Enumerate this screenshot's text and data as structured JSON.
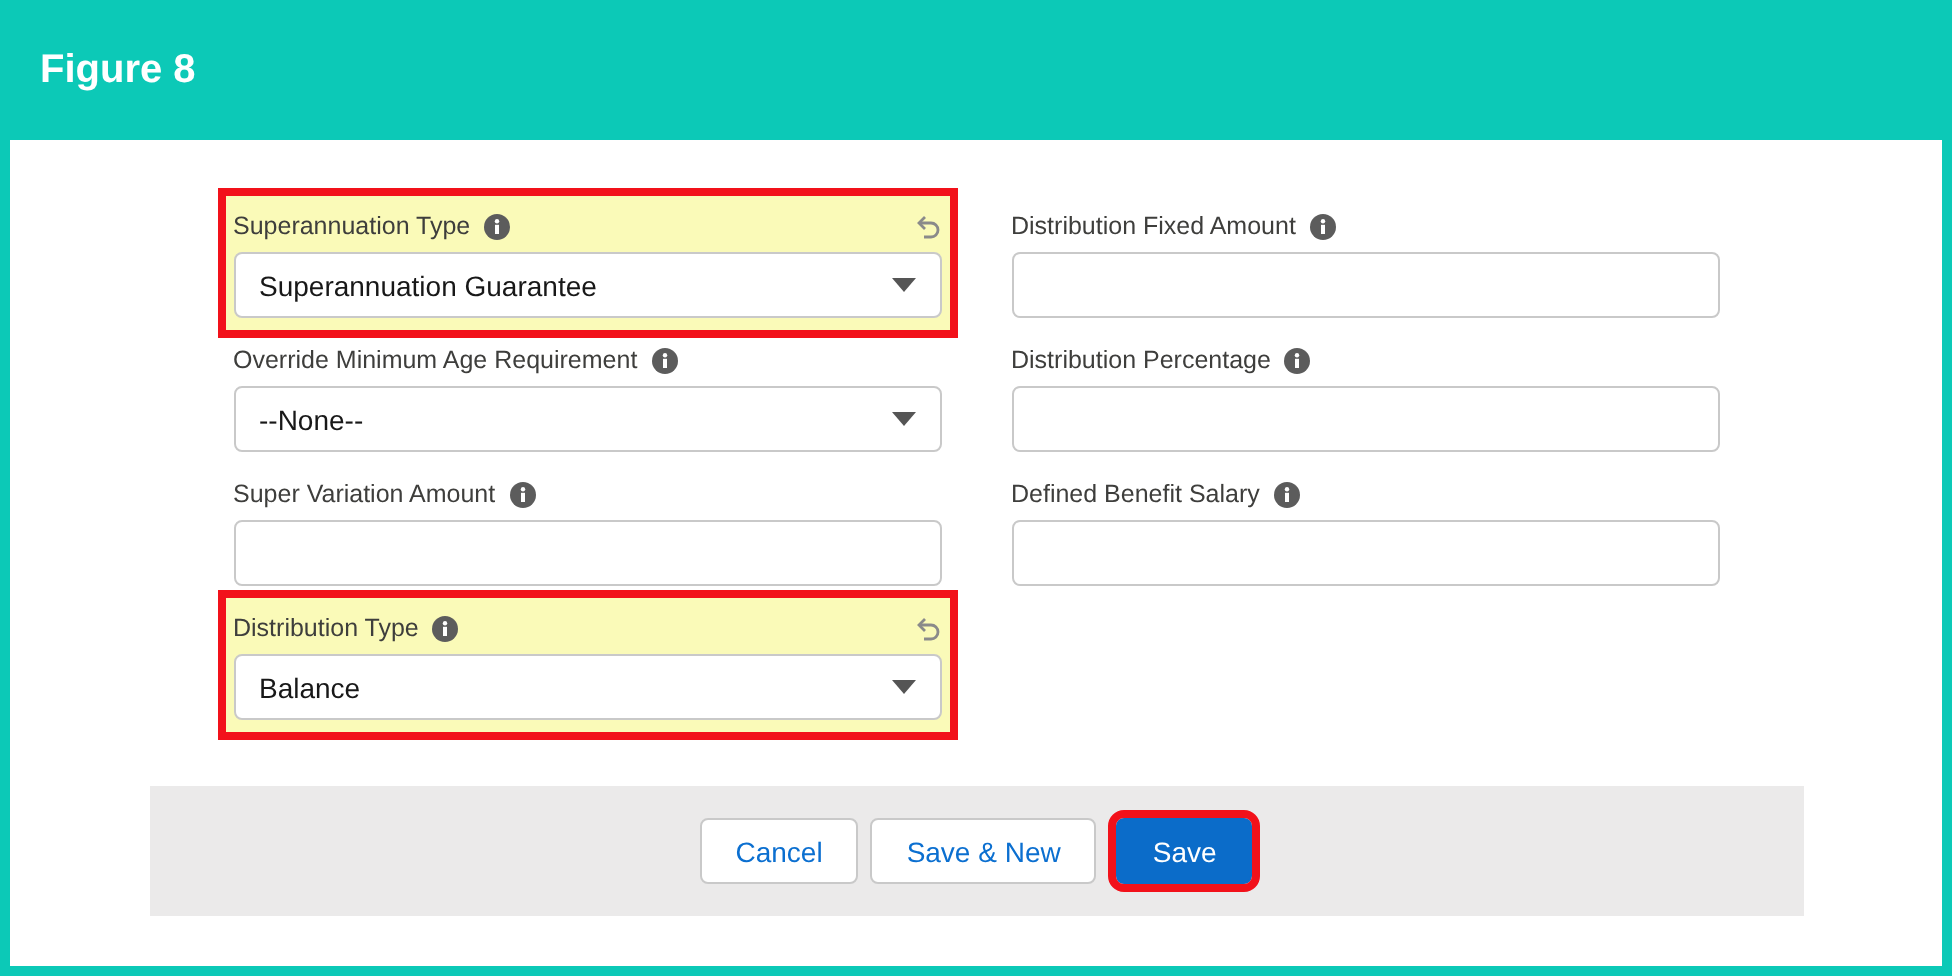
{
  "figure": {
    "title": "Figure 8"
  },
  "columns": [
    {
      "fields": [
        {
          "label": "Superannuation Type",
          "kind": "picklist",
          "value": "Superannuation Guarantee",
          "changed": true
        },
        {
          "label": "Override Minimum Age Requirement",
          "kind": "picklist",
          "value": "--None--",
          "changed": false
        },
        {
          "label": "Super Variation Amount",
          "kind": "text",
          "changed": false
        },
        {
          "label": "Distribution Type",
          "kind": "picklist",
          "value": "Balance",
          "changed": true
        }
      ]
    },
    {
      "fields": [
        {
          "label": "Distribution Fixed Amount",
          "kind": "text",
          "changed": false
        },
        {
          "label": "Distribution Percentage",
          "kind": "text",
          "changed": false
        },
        {
          "label": "Defined Benefit Salary",
          "kind": "text",
          "changed": false
        }
      ]
    }
  ],
  "buttons": [
    {
      "label": "Cancel",
      "kind": "neutral",
      "highlighted": false
    },
    {
      "label": "Save & New",
      "kind": "neutral",
      "highlighted": false
    },
    {
      "label": "Save",
      "kind": "brand",
      "highlighted": true
    }
  ]
}
